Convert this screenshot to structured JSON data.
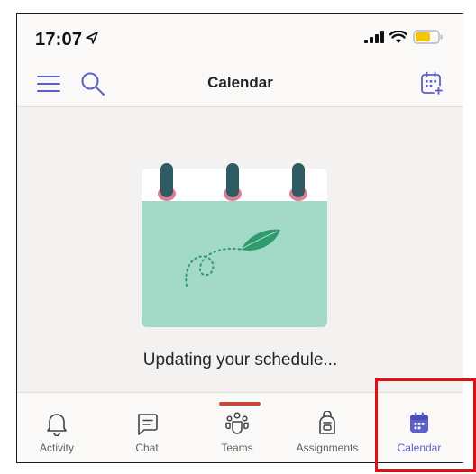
{
  "status_bar": {
    "time": "17:07",
    "icons": [
      "location-arrow-icon",
      "signal-icon",
      "wifi-icon",
      "battery-icon"
    ]
  },
  "header": {
    "title": "Calendar",
    "left_icons": [
      "menu-icon",
      "search-icon"
    ],
    "right_icon": "calendar-add-icon"
  },
  "content": {
    "illustration": "calendar-with-leaf-illustration",
    "message": "Updating your schedule..."
  },
  "tabs": [
    {
      "label": "Activity",
      "icon": "bell-icon",
      "active": false
    },
    {
      "label": "Chat",
      "icon": "chat-icon",
      "active": false
    },
    {
      "label": "Teams",
      "icon": "teams-icon",
      "active": false
    },
    {
      "label": "Assignments",
      "icon": "backpack-icon",
      "active": false
    },
    {
      "label": "Calendar",
      "icon": "calendar-icon",
      "active": true
    }
  ],
  "colors": {
    "accent": "#5b5fc7",
    "indicator": "#c4493a",
    "calendar_body": "#a3d9c7",
    "ring_pin": "#2f5b62",
    "ring_base": "#dc7f95",
    "leaf": "#2e9a6e",
    "highlight": "#e01010"
  }
}
